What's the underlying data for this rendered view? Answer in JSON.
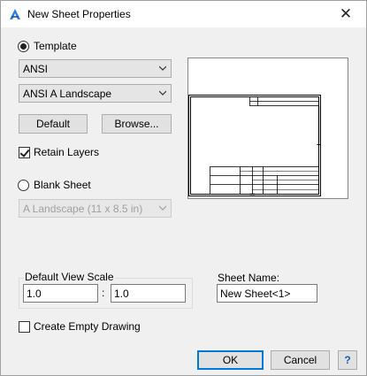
{
  "window": {
    "title": "New Sheet Properties",
    "close_glyph": "✕"
  },
  "template": {
    "radio_label": "Template",
    "selected": true,
    "standard_value": "ANSI",
    "sheet_value": "ANSI A Landscape",
    "default_button": "Default",
    "browse_button": "Browse...",
    "retain_layers_label": "Retain Layers",
    "retain_layers_checked": true
  },
  "blank_sheet": {
    "radio_label": "Blank Sheet",
    "selected": false,
    "size_value": "A Landscape (11 x 8.5 in)"
  },
  "view_scale": {
    "group_label": "Default View Scale",
    "numerator": "1.0",
    "separator": ":",
    "denominator": "1.0"
  },
  "sheet_name": {
    "label": "Sheet Name:",
    "value": "New Sheet<1>"
  },
  "create_empty_drawing": {
    "label": "Create Empty Drawing",
    "checked": false
  },
  "buttons": {
    "ok": "OK",
    "cancel": "Cancel",
    "help": "?"
  },
  "colors": {
    "accent": "#0078d7",
    "icon_blue": "#2a7de1"
  }
}
